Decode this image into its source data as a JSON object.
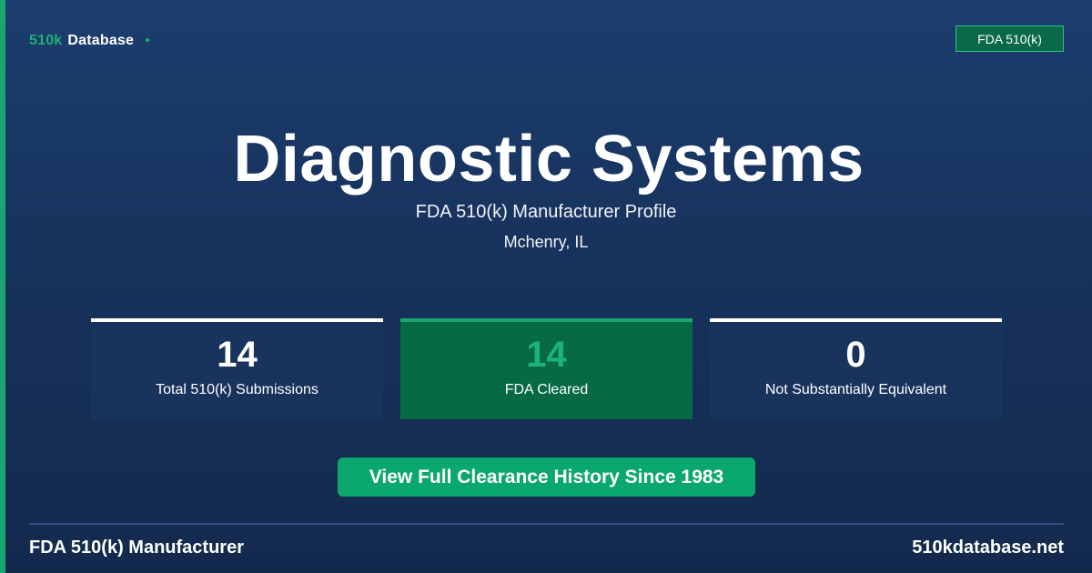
{
  "brand": {
    "accent": "510k",
    "name": "Database"
  },
  "header": {
    "badge": "FDA 510(k)"
  },
  "hero": {
    "title": "Diagnostic Systems",
    "subtitle": "FDA 510(k) Manufacturer Profile",
    "location": "Mchenry, IL"
  },
  "stats": [
    {
      "value": "14",
      "label": "Total 510(k) Submissions"
    },
    {
      "value": "14",
      "label": "FDA Cleared"
    },
    {
      "value": "0",
      "label": "Not Substantially Equivalent"
    }
  ],
  "cta": {
    "label": "View Full Clearance History Since 1983"
  },
  "footer": {
    "left": "FDA 510(k) Manufacturer",
    "right": "510kdatabase.net"
  },
  "colors": {
    "background": "#17325c",
    "accent_green": "#1db27c",
    "cleared_card": "#066a45",
    "button": "#0ba86d"
  }
}
